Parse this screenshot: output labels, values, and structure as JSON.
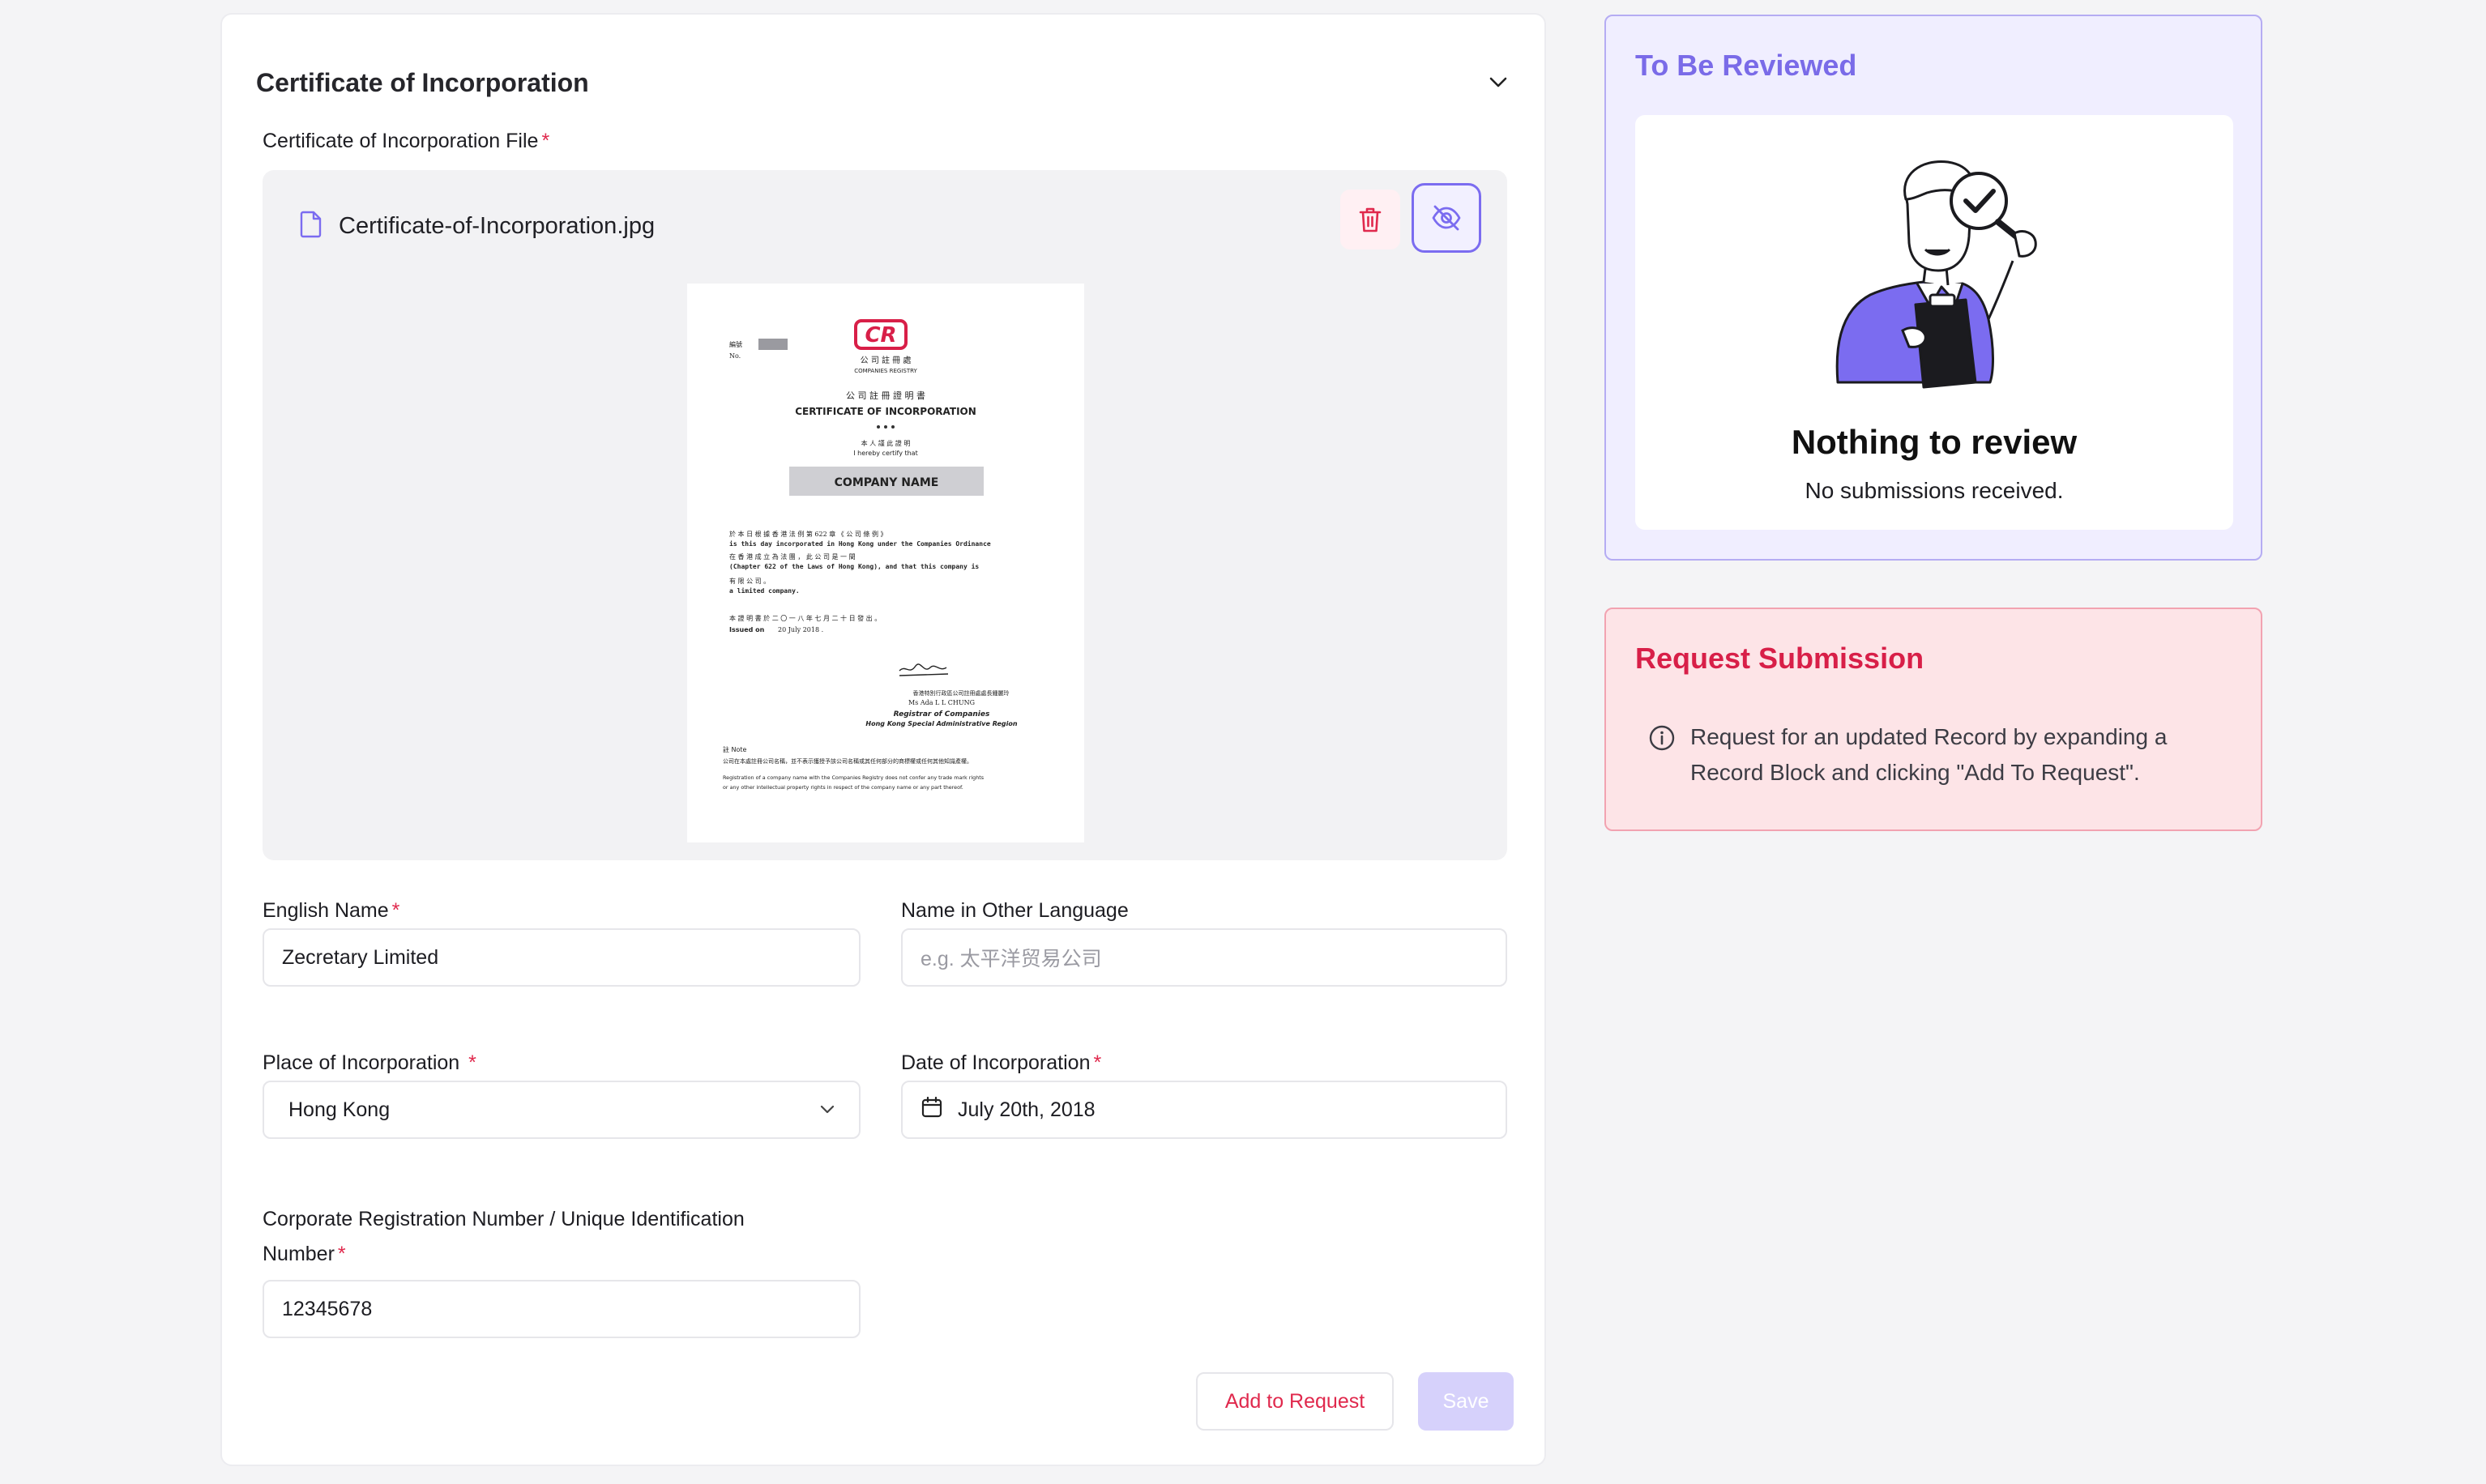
{
  "card": {
    "title": "Certificate of Incorporation",
    "file_label": "Certificate of Incorporation File",
    "file_name": "Certificate-of-Incorporation.jpg",
    "required_mark": "*",
    "fields": {
      "english_name": {
        "label": "English Name",
        "value": "Zecretary Limited"
      },
      "other_name": {
        "label": "Name in Other Language",
        "placeholder": "e.g. 太平洋贸易公司"
      },
      "place": {
        "label": "Place of Incorporation",
        "value": "Hong Kong"
      },
      "date": {
        "label": "Date of Incorporation",
        "value": "July 20th, 2018"
      },
      "crn": {
        "label_line1": "Corporate Registration Number / Unique Identification",
        "label_line2": "Number",
        "value": "12345678"
      }
    },
    "buttons": {
      "add": "Add to Request",
      "save": "Save"
    }
  },
  "doc": {
    "logo": "CR",
    "reg_cn": "公 司 註 冊 處",
    "reg_en": "COMPANIES REGISTRY",
    "no_label": "編號",
    "no_label_en": "No.",
    "cert_cn": "公 司 註 冊 證 明 書",
    "cert_en": "CERTIFICATE OF INCORPORATION",
    "certify_cn": "本 人 謹 此 證 明",
    "certify_en": "I hereby certify that",
    "company": "COMPANY NAME",
    "line1_cn": "於 本 日 根 據 香 港 法 例 第 622 章 《 公 司 條 例 》",
    "line1_en": "is this day incorporated in Hong Kong under the Companies Ordinance",
    "line2_cn": "在 香 港 成 立 為 法 團 ， 此 公 司 是 一 間",
    "line2_en": "(Chapter 622 of the Laws of Hong Kong), and that this company is",
    "line3_cn": "有 限 公 司 。",
    "line3_en": "a limited company.",
    "issued_cn": "本 證 明 書 於 二 〇 一 八 年 七 月 二 十 日 發 出 。",
    "issued_en": "Issued on",
    "issued_date": "20 July 2018 .",
    "signatory_cn": "香港特別行政區公司註冊處處長鍾麗玲",
    "signatory": "Ms Ada L L CHUNG",
    "signatory_title": "Registrar of Companies",
    "signatory_region": "Hong Kong Special Administrative Region",
    "note_label": "註 Note",
    "note_cn": "公司在本處註冊公司名稱，並不表示獲授予該公司名稱或其任何部分的商標權或任何其他知識產權。",
    "note_en1": "Registration of a company name with the Companies Registry does not confer any trade mark rights",
    "note_en2": "or any other intellectual property rights in respect of the company name or any part thereof."
  },
  "review": {
    "title": "To Be Reviewed",
    "empty_title": "Nothing to review",
    "empty_sub": "No submissions received."
  },
  "request": {
    "title": "Request Submission",
    "text": "Request for an updated Record by expanding a Record Block and clicking \"Add To Request\"."
  },
  "colors": {
    "accent": "#7a6be8",
    "danger": "#d81f48",
    "required": "#e0294d"
  }
}
